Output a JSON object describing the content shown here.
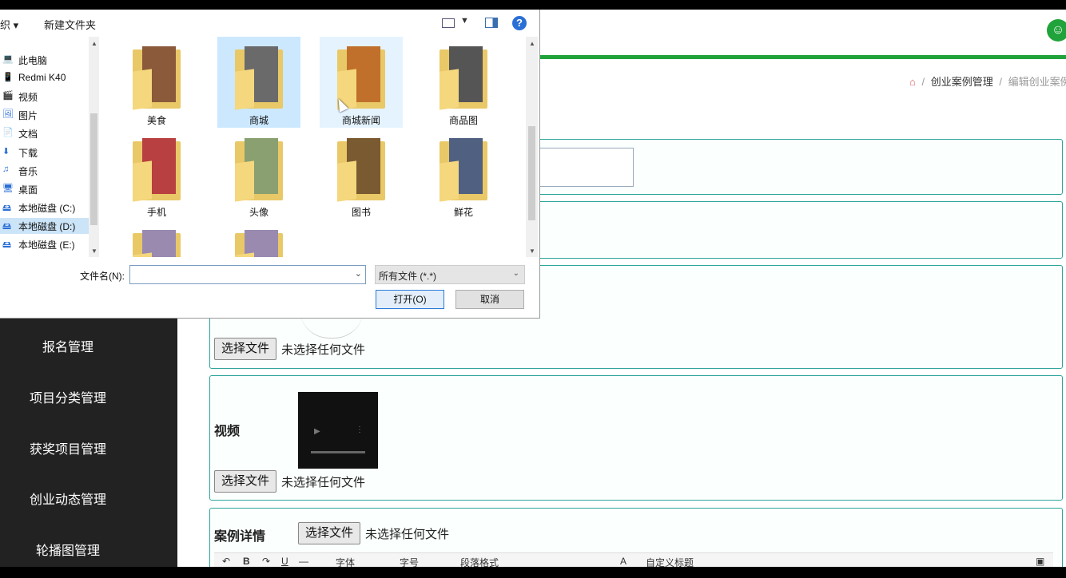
{
  "dialog": {
    "toolbar": {
      "organize_label": "织 ▾",
      "new_folder_label": "新建文件夹",
      "help_label": "?"
    },
    "nav": [
      {
        "label": "此电脑",
        "icon": "computer-icon",
        "selected": false
      },
      {
        "label": "Redmi K40",
        "icon": "phone-icon",
        "selected": false
      },
      {
        "label": "视频",
        "icon": "video-library-icon",
        "selected": false
      },
      {
        "label": "图片",
        "icon": "pictures-icon",
        "selected": false
      },
      {
        "label": "文档",
        "icon": "documents-icon",
        "selected": false
      },
      {
        "label": "下载",
        "icon": "download-icon",
        "selected": false
      },
      {
        "label": "音乐",
        "icon": "music-icon",
        "selected": false
      },
      {
        "label": "桌面",
        "icon": "desktop-icon",
        "selected": false
      },
      {
        "label": "本地磁盘 (C:)",
        "icon": "drive-icon",
        "selected": false
      },
      {
        "label": "本地磁盘 (D:)",
        "icon": "drive-icon",
        "selected": true
      },
      {
        "label": "本地磁盘 (E:)",
        "icon": "drive-icon",
        "selected": false
      }
    ],
    "folders": [
      {
        "name": "美食",
        "color": "#8a5a3a"
      },
      {
        "name": "商城",
        "color": "#6a6a6a"
      },
      {
        "name": "商城新闻",
        "color": "#c0702a"
      },
      {
        "name": "商品图",
        "color": "#555555"
      },
      {
        "name": "手机",
        "color": "#b84040"
      },
      {
        "name": "头像",
        "color": "#8aa070"
      },
      {
        "name": "图书",
        "color": "#7a5a30"
      },
      {
        "name": "鲜花",
        "color": "#506080"
      }
    ],
    "filename_label": "文件名(N):",
    "filename_value": "",
    "filetype_value": "所有文件 (*.*)",
    "open_label": "打开(O)",
    "cancel_label": "取消"
  },
  "breadcrumb": {
    "section": "创业案例管理",
    "current": "编辑创业案例"
  },
  "sidebar": {
    "items": [
      "报名管理",
      "项目分类管理",
      "获奖项目管理",
      "创业动态管理",
      "轮播图管理"
    ]
  },
  "form": {
    "image_field": {
      "button": "选择文件",
      "status": "未选择任何文件"
    },
    "video_field": {
      "label": "视频",
      "button": "选择文件",
      "status": "未选择任何文件"
    },
    "detail_field": {
      "label": "案例详情",
      "button": "选择文件",
      "status": "未选择任何文件"
    },
    "editor": {
      "font": "字体",
      "size": "字号",
      "paragraph": "段落格式",
      "custom_title": "自定义标题"
    }
  },
  "colors": {
    "accent": "#21a33b",
    "panel_border": "#2da59a",
    "sidebar": "#222222"
  }
}
